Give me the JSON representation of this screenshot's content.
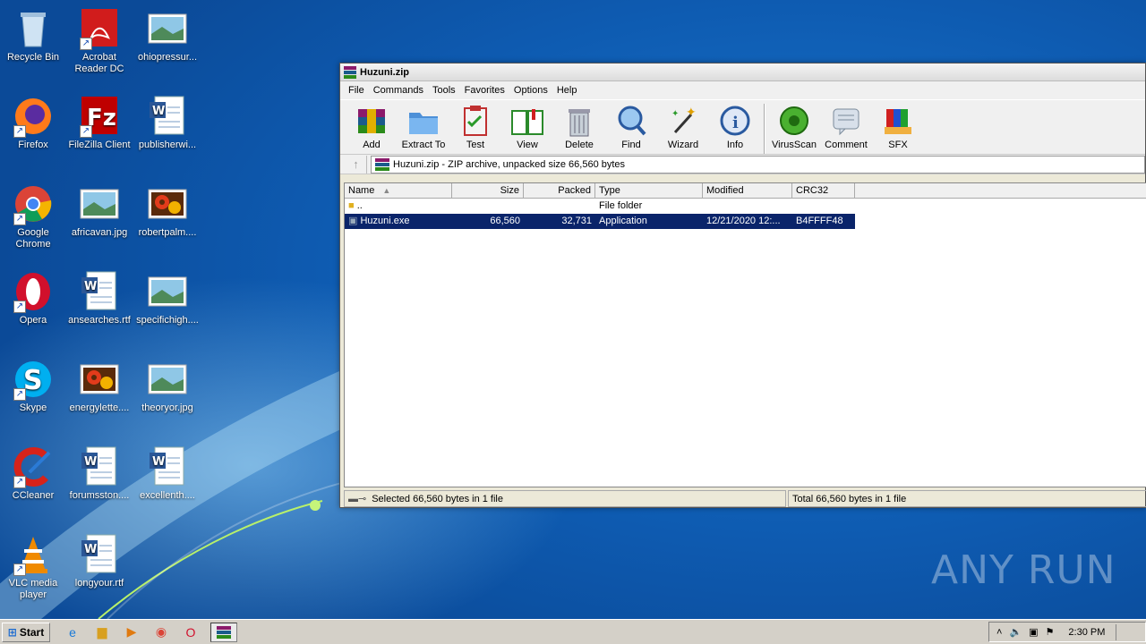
{
  "desktop": {
    "icons": [
      {
        "label": "Recycle Bin",
        "icon": "recycle-bin-icon"
      },
      {
        "label": "Acrobat Reader DC",
        "icon": "acrobat-icon"
      },
      {
        "label": "ohiopressur...",
        "icon": "image-file-icon"
      },
      {
        "label": "Firefox",
        "icon": "firefox-icon"
      },
      {
        "label": "FileZilla Client",
        "icon": "filezilla-icon"
      },
      {
        "label": "publisherwi...",
        "icon": "word-doc-icon"
      },
      {
        "label": "Google Chrome",
        "icon": "chrome-icon"
      },
      {
        "label": "africavan.jpg",
        "icon": "image-file-icon"
      },
      {
        "label": "robertpalm....",
        "icon": "image-flowers-icon"
      },
      {
        "label": "Opera",
        "icon": "opera-icon"
      },
      {
        "label": "ansearches.rtf",
        "icon": "word-doc-icon"
      },
      {
        "label": "specifichigh....",
        "icon": "image-file-icon"
      },
      {
        "label": "Skype",
        "icon": "skype-icon"
      },
      {
        "label": "energylette....",
        "icon": "image-flowers-icon"
      },
      {
        "label": "theoryor.jpg",
        "icon": "image-file-icon"
      },
      {
        "label": "CCleaner",
        "icon": "ccleaner-icon"
      },
      {
        "label": "forumsston....",
        "icon": "word-doc-icon"
      },
      {
        "label": "excellenth....",
        "icon": "word-doc-icon"
      },
      {
        "label": "VLC media player",
        "icon": "vlc-icon"
      },
      {
        "label": "longyour.rtf",
        "icon": "word-doc-icon"
      }
    ],
    "watermark": "ANY RUN"
  },
  "window": {
    "title": "Huzuni.zip",
    "menu": [
      "File",
      "Commands",
      "Tools",
      "Favorites",
      "Options",
      "Help"
    ],
    "toolbar": [
      {
        "label": "Add",
        "icon": "add-archive-icon"
      },
      {
        "label": "Extract To",
        "icon": "extract-folder-icon"
      },
      {
        "label": "Test",
        "icon": "test-clipboard-icon"
      },
      {
        "label": "View",
        "icon": "view-book-icon"
      },
      {
        "label": "Delete",
        "icon": "trash-can-icon"
      },
      {
        "label": "Find",
        "icon": "magnifier-icon"
      },
      {
        "label": "Wizard",
        "icon": "wizard-wand-icon"
      },
      {
        "label": "Info",
        "icon": "info-icon"
      },
      {
        "label": "VirusScan",
        "icon": "virus-scan-icon"
      },
      {
        "label": "Comment",
        "icon": "comment-icon"
      },
      {
        "label": "SFX",
        "icon": "sfx-books-icon"
      }
    ],
    "path": "Huzuni.zip - ZIP archive, unpacked size 66,560 bytes",
    "columns": [
      "Name",
      "Size",
      "Packed",
      "Type",
      "Modified",
      "CRC32"
    ],
    "rows": [
      {
        "name": "..",
        "size": "",
        "packed": "",
        "type": "File folder",
        "modified": "",
        "crc": ""
      },
      {
        "name": "Huzuni.exe",
        "size": "66,560",
        "packed": "32,731",
        "type": "Application",
        "modified": "12/21/2020 12:...",
        "crc": "B4FFFF48"
      }
    ],
    "status_left": "Selected 66,560 bytes in 1 file",
    "status_right": "Total 66,560 bytes in 1 file"
  },
  "taskbar": {
    "start": "Start",
    "clock": "2:30 PM",
    "items": [
      "ie-icon",
      "explorer-icon",
      "media-player-icon",
      "chrome-icon",
      "opera-icon",
      "winrar-icon"
    ]
  }
}
